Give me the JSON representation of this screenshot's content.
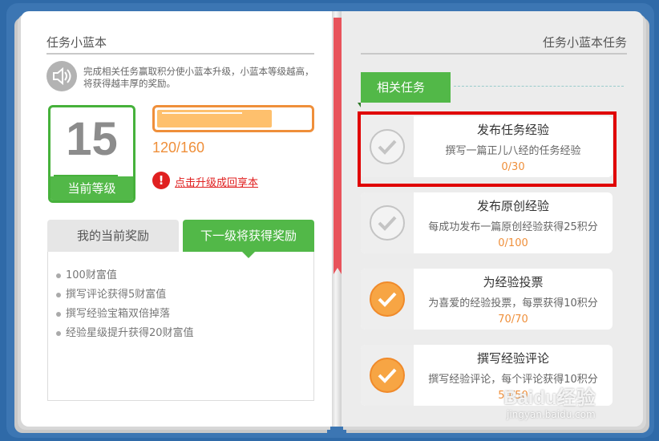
{
  "left": {
    "title": "任务小蓝本",
    "notice": "完成相关任务赢取积分使小蓝本升级，小蓝本等级越高，将获得越丰厚的奖励。",
    "level": {
      "value": "15",
      "label": "当前等级"
    },
    "progress": {
      "text": "120/160",
      "fraction": 0.75
    },
    "upgrade_link": "点击升级成回享本",
    "tabs": {
      "current": "我的当前奖励",
      "next": "下一级将获得奖励"
    },
    "rewards": [
      "100财富值",
      "撰写评论获得5财富值",
      "撰写经验宝箱双倍掉落",
      "经验星级提升获得20财富值"
    ]
  },
  "right": {
    "title": "任务小蓝本任务",
    "ribbon": "相关任务",
    "tasks": [
      {
        "name": "发布任务经验",
        "desc": "撰写一篇正儿八经的任务经验",
        "progress": "0/30",
        "done": false
      },
      {
        "name": "发布原创经验",
        "desc": "每成功发布一篇原创经验获得25积分",
        "progress": "0/100",
        "done": false
      },
      {
        "name": "为经验投票",
        "desc": "为喜爱的经验投票，每票获得10积分",
        "progress": "70/70",
        "done": true
      },
      {
        "name": "撰写经验评论",
        "desc": "撰写经验评论，每个评论获得10积分",
        "progress": "50/50",
        "done": true
      }
    ]
  },
  "watermark": {
    "logo": "Baidu经验",
    "url": "jingyan.baidu.com"
  },
  "colors": {
    "green": "#52b848",
    "orange": "#ef8f3a",
    "red": "#e00000",
    "frame": "#2f6aa8"
  }
}
